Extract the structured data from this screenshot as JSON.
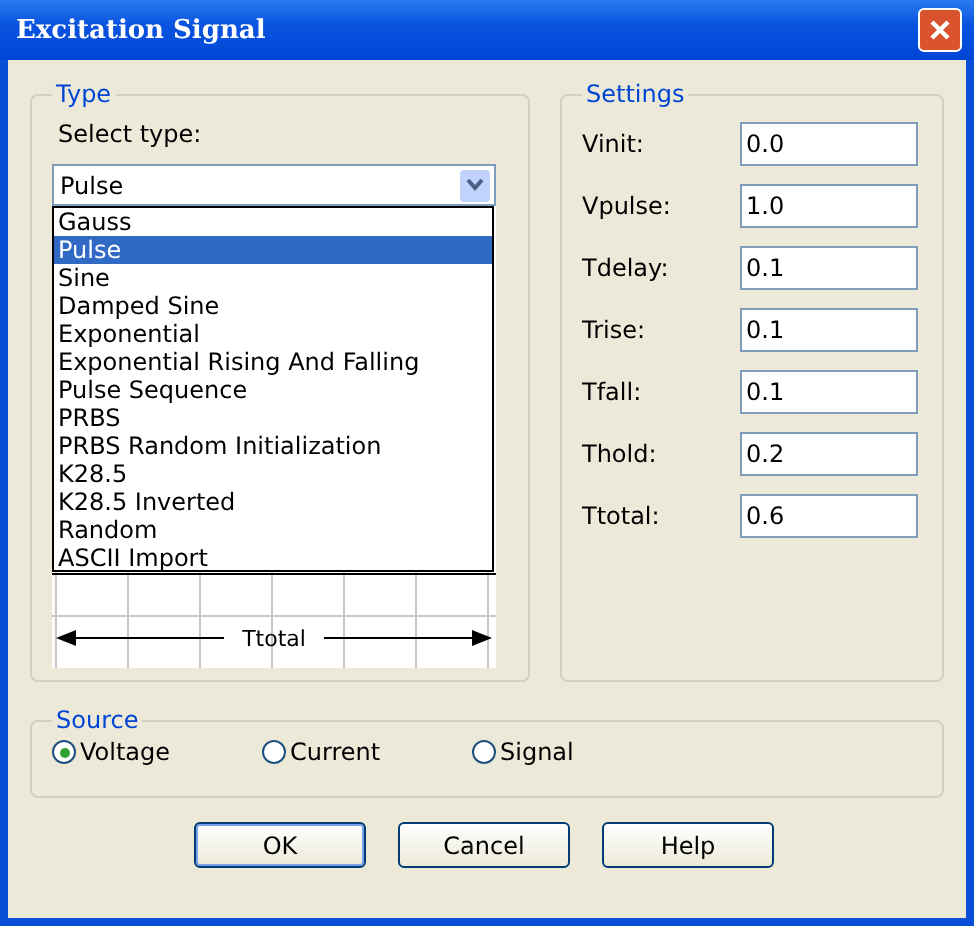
{
  "window": {
    "title": "Excitation Signal"
  },
  "type_group": {
    "title": "Type",
    "select_label": "Select type:",
    "combo_value": "Pulse",
    "options": [
      {
        "label": "Gauss",
        "selected": false
      },
      {
        "label": "Pulse",
        "selected": true
      },
      {
        "label": "Sine",
        "selected": false
      },
      {
        "label": "Damped Sine",
        "selected": false
      },
      {
        "label": "Exponential",
        "selected": false
      },
      {
        "label": "Exponential Rising And Falling",
        "selected": false
      },
      {
        "label": "Pulse Sequence",
        "selected": false
      },
      {
        "label": "PRBS",
        "selected": false
      },
      {
        "label": "PRBS Random Initialization",
        "selected": false
      },
      {
        "label": "K28.5",
        "selected": false
      },
      {
        "label": "K28.5 Inverted",
        "selected": false
      },
      {
        "label": "Random",
        "selected": false
      },
      {
        "label": "ASCII Import",
        "selected": false
      }
    ],
    "diagram_label": "Ttotal"
  },
  "settings": {
    "title": "Settings",
    "fields": [
      {
        "label": "Vinit:",
        "value": "0.0"
      },
      {
        "label": "Vpulse:",
        "value": "1.0"
      },
      {
        "label": "Tdelay:",
        "value": "0.1"
      },
      {
        "label": "Trise:",
        "value": "0.1"
      },
      {
        "label": "Tfall:",
        "value": "0.1"
      },
      {
        "label": "Thold:",
        "value": "0.2"
      },
      {
        "label": "Ttotal:",
        "value": "0.6"
      }
    ]
  },
  "source": {
    "title": "Source",
    "options": [
      {
        "label": "Voltage",
        "selected": true
      },
      {
        "label": "Current",
        "selected": false
      },
      {
        "label": "Signal",
        "selected": false
      }
    ]
  },
  "buttons": [
    "OK",
    "Cancel",
    "Help"
  ]
}
